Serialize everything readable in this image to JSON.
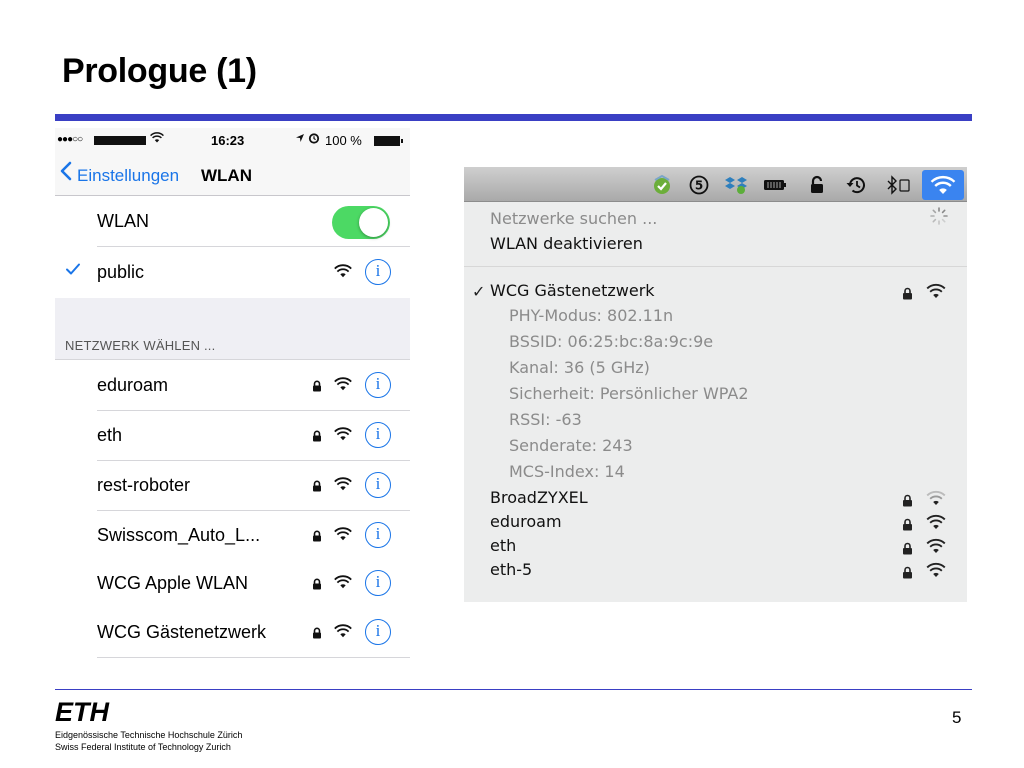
{
  "slide": {
    "title": "Prologue (1)",
    "page_number": "5",
    "accent_color": "#3a3fc4"
  },
  "ios": {
    "status": {
      "signal": "●●●○○",
      "time": "16:23",
      "battery": "100 %"
    },
    "nav": {
      "back_label": "Einstellungen",
      "title": "WLAN"
    },
    "wlan_toggle": {
      "label": "WLAN",
      "on": true,
      "color": "#4cd964"
    },
    "connected": {
      "name": "public"
    },
    "section_header": "NETZWERK WÄHLEN ...",
    "networks": [
      {
        "name": "eduroam"
      },
      {
        "name": "eth"
      },
      {
        "name": "rest-roboter"
      },
      {
        "name": "Swisscom_Auto_L..."
      },
      {
        "name": "WCG Apple WLAN"
      },
      {
        "name": "WCG Gästenetzwerk"
      }
    ],
    "info_glyph": "i",
    "tint_color": "#1a75e8"
  },
  "mac": {
    "menubar_icons": [
      "checkmark-shield-icon",
      "s-badge-icon",
      "dropbox-icon",
      "battery-icon",
      "lock-icon",
      "time-machine-icon",
      "bluetooth-icon",
      "wifi-icon"
    ],
    "scan_label": "Netzwerke suchen ...",
    "disable_label": "WLAN deaktivieren",
    "connected": {
      "name": "WCG Gästenetzwerk",
      "details": [
        "PHY-Modus: 802.11n",
        "BSSID: 06:25:bc:8a:9c:9e",
        "Kanal: 36 (5 GHz)",
        "Sicherheit: Persönlicher WPA2",
        "RSSI: -63",
        "Senderate: 243",
        "MCS-Index: 14"
      ]
    },
    "networks": [
      {
        "name": "BroadZYXEL"
      },
      {
        "name": "eduroam"
      },
      {
        "name": "eth"
      },
      {
        "name": "eth-5"
      }
    ],
    "selected_color": "#3a84f0"
  },
  "footer": {
    "logo": "ETH",
    "line1": "Eidgenössische Technische Hochschule Zürich",
    "line2": "Swiss Federal Institute of Technology Zurich"
  }
}
